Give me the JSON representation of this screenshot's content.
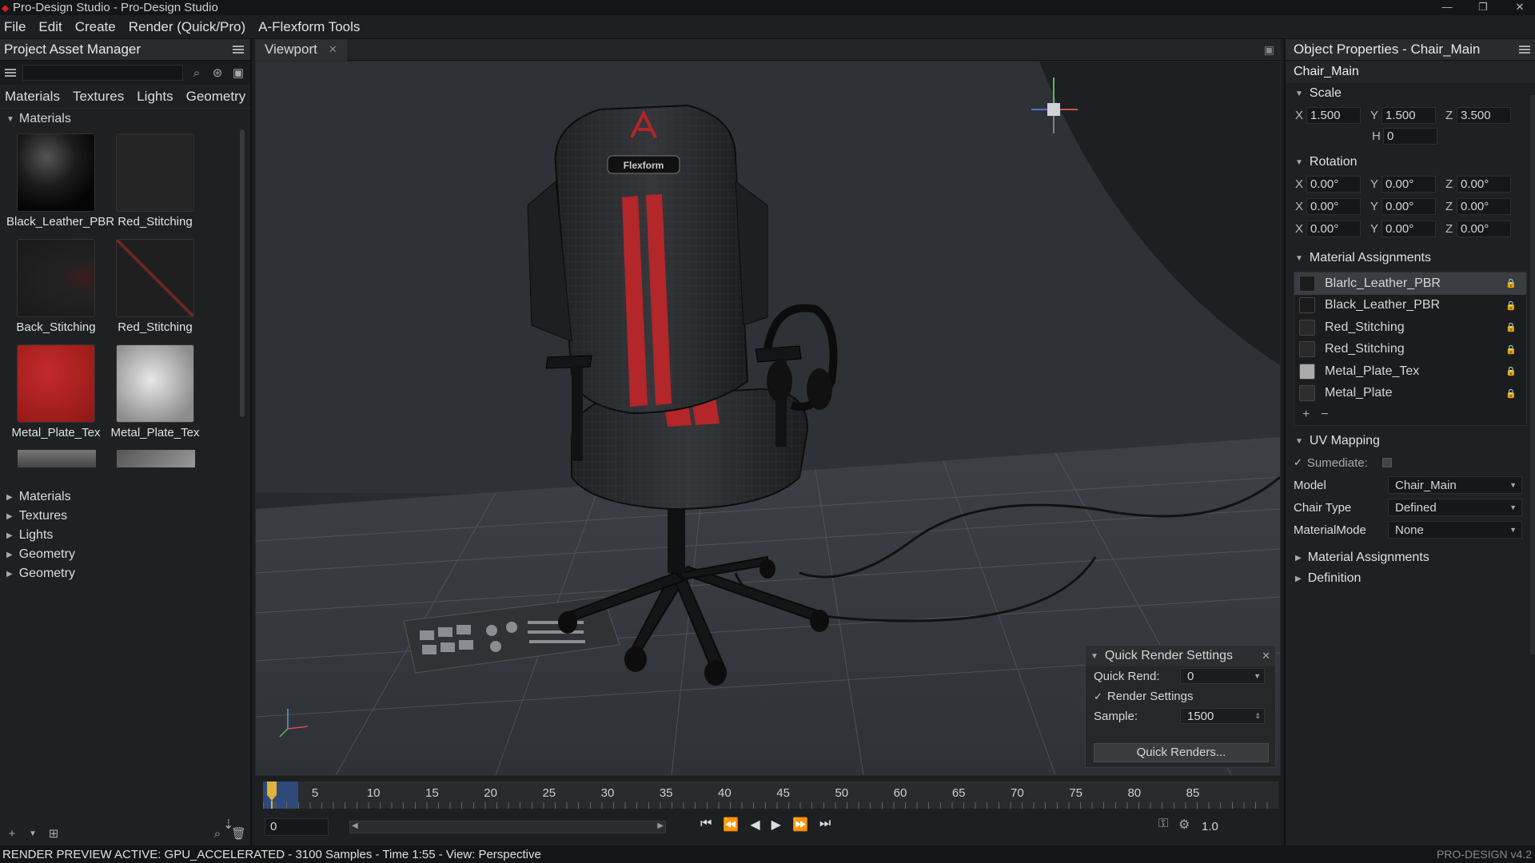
{
  "window": {
    "title": "Pro-Design Studio - Pro-Design Studio"
  },
  "menu": [
    "File",
    "Edit",
    "Create",
    "Render (Quick/Pro)",
    "A-Flexform Tools"
  ],
  "left_panel": {
    "title": "Project Asset Manager",
    "tabs": [
      "Materials",
      "Textures",
      "Lights",
      "Geometry"
    ],
    "group": "Materials",
    "materials": [
      {
        "label": "Black_Leather_PBR",
        "swatch": "#1a1a1a"
      },
      {
        "label": "Red_Stitching",
        "swatch": "#252525"
      },
      {
        "label": "Back_Stitching",
        "swatch": "#222222"
      },
      {
        "label": "Red_Stitching",
        "swatch": "#1f1f1f"
      },
      {
        "label": "Metal_Plate_Tex",
        "swatch": "#a51e1e"
      },
      {
        "label": "Metal_Plate_Tex",
        "swatch": "#b9b9b9"
      }
    ],
    "tree": [
      "Materials",
      "Textures",
      "Lights",
      "Geometry",
      "Geometry"
    ]
  },
  "viewport": {
    "tab": "Viewport",
    "chair_logo": "Flexform"
  },
  "quick_render": {
    "title": "Quick Render Settings",
    "quick_rend_label": "Quick Rend:",
    "quick_rend_value": "0",
    "render_settings_label": "Render Settings",
    "sample_label": "Sample:",
    "sample_value": "1500",
    "button": "Quick Renders..."
  },
  "timeline": {
    "ticks": [
      "5",
      "10",
      "15",
      "20",
      "25",
      "30",
      "35",
      "40",
      "45",
      "50",
      "60",
      "65",
      "70",
      "75",
      "80",
      "85"
    ],
    "frame": "0",
    "speed": "1.0"
  },
  "right_panel": {
    "title": "Object Properties - Chair_Main",
    "object_name": "Chair_Main",
    "scale": {
      "label": "Scale",
      "x": "1.500",
      "y": "1.500",
      "z": "3.500",
      "h": "0"
    },
    "rotation": {
      "label": "Rotation",
      "rows": [
        {
          "x": "0.00°",
          "y": "0.00°",
          "z": "0.00°"
        },
        {
          "x": "0.00°",
          "y": "0.00°",
          "z": "0.00°"
        },
        {
          "x": "0.00°",
          "y": "0.00°",
          "z": "0.00°"
        }
      ]
    },
    "material_assignments": {
      "label": "Material Assignments",
      "items": [
        {
          "label": "Blarlc_Leather_PBR",
          "swatch": "#1b1b1b"
        },
        {
          "label": "Black_Leather_PBR",
          "swatch": "#1b1b1b"
        },
        {
          "label": "Red_Stitching",
          "swatch": "#2a2a2a"
        },
        {
          "label": "Red_Stitching",
          "swatch": "#2a2a2a"
        },
        {
          "label": "Metal_Plate_Tex",
          "swatch": "#aaaaaa"
        },
        {
          "label": "Metal_Plate",
          "swatch": "#2e2e2e"
        }
      ]
    },
    "uv_mapping": {
      "label": "UV Mapping",
      "check_label": "Sumediate:",
      "fields": [
        {
          "label": "Model",
          "value": "Chair_Main"
        },
        {
          "label": "Chair Type",
          "value": "Defined"
        },
        {
          "label": "MaterialMode",
          "value": "None"
        }
      ]
    },
    "collapsed": [
      "Material Assignments",
      "Definition"
    ]
  },
  "status": {
    "text": "RENDER PREVIEW ACTIVE: GPU_ACCELERATED - 3100 Samples - Time 1:55 - View: Perspective",
    "version": "PRO-DESIGN v4.2"
  },
  "colors": {
    "accent_red": "#b3262a",
    "playhead": "#e0b040",
    "selection": "#3a3d42"
  }
}
